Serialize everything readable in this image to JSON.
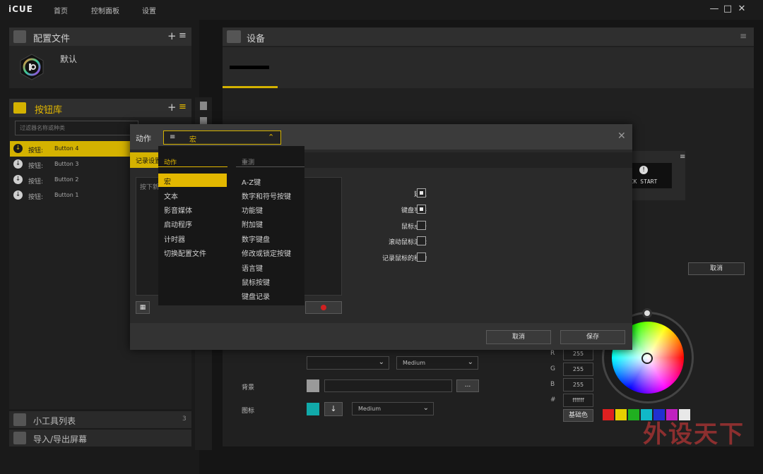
{
  "app": {
    "name": "iCUE"
  },
  "nav": [
    {
      "label": "首页"
    },
    {
      "label": "控制面板"
    },
    {
      "label": "设置"
    }
  ],
  "window_controls": [
    "minimize-icon",
    "maximize-icon",
    "close-icon"
  ],
  "profiles": {
    "title": "配置文件",
    "default_label": "默认"
  },
  "button_library": {
    "title": "按钮库",
    "search_placeholder": "过滤器名称或种类",
    "items": [
      {
        "kind": "按钮:",
        "name": "Button 4",
        "active": true
      },
      {
        "kind": "按钮:",
        "name": "Button 3",
        "active": false
      },
      {
        "kind": "按钮:",
        "name": "Button 2",
        "active": false
      },
      {
        "kind": "按钮:",
        "name": "Button 1",
        "active": false
      }
    ]
  },
  "widgets": {
    "title": "小工具列表",
    "count": "3"
  },
  "import_export": {
    "title": "导入/导出屏幕"
  },
  "devices": {
    "title": "设备",
    "preview_text": "ICK START",
    "cancel": "取消"
  },
  "modal": {
    "title": "动作",
    "selected_action": "宏",
    "record_tab": "记录设置",
    "press_placeholder": "按下新",
    "checkboxes": [
      {
        "label": "延迟",
        "checked": true
      },
      {
        "label": "键盘事件",
        "checked": true
      },
      {
        "label": "鼠标点击",
        "checked": false
      },
      {
        "label": "滚动鼠标滚轮",
        "checked": false
      },
      {
        "label": "记录鼠标的移动",
        "checked": false
      }
    ],
    "cancel": "取消",
    "save": "保存"
  },
  "action_menu": {
    "col1_header": "动作",
    "col1": [
      "宏",
      "文本",
      "影音媒体",
      "启动程序",
      "计时器",
      "切换配置文件"
    ],
    "col2_header": "重测",
    "col2": [
      "A-Z键",
      "数字和符号按键",
      "功能键",
      "附加键",
      "数字键盘",
      "修改或锁定按键",
      "语言键",
      "鼠标按键",
      "键盘记录"
    ]
  },
  "lighting": {
    "medium_1": "Medium",
    "bg_label": "背景",
    "ellipsis": "...",
    "icon_label": "图标",
    "medium_2": "Medium",
    "bg_color": "#9a9a9a",
    "icon_color": "#11a9a9",
    "r_label": "R",
    "r": "255",
    "g_label": "G",
    "g": "255",
    "b_label": "B",
    "b": "255",
    "hex_label": "#",
    "hex": "ffffff",
    "basic_colors": "基础色",
    "swatches": [
      "#e02020",
      "#e8d000",
      "#20b020",
      "#10b8c8",
      "#2030d0",
      "#c020c0",
      "#e8e8e8"
    ]
  },
  "watermark": {
    "text": "外设天下"
  }
}
